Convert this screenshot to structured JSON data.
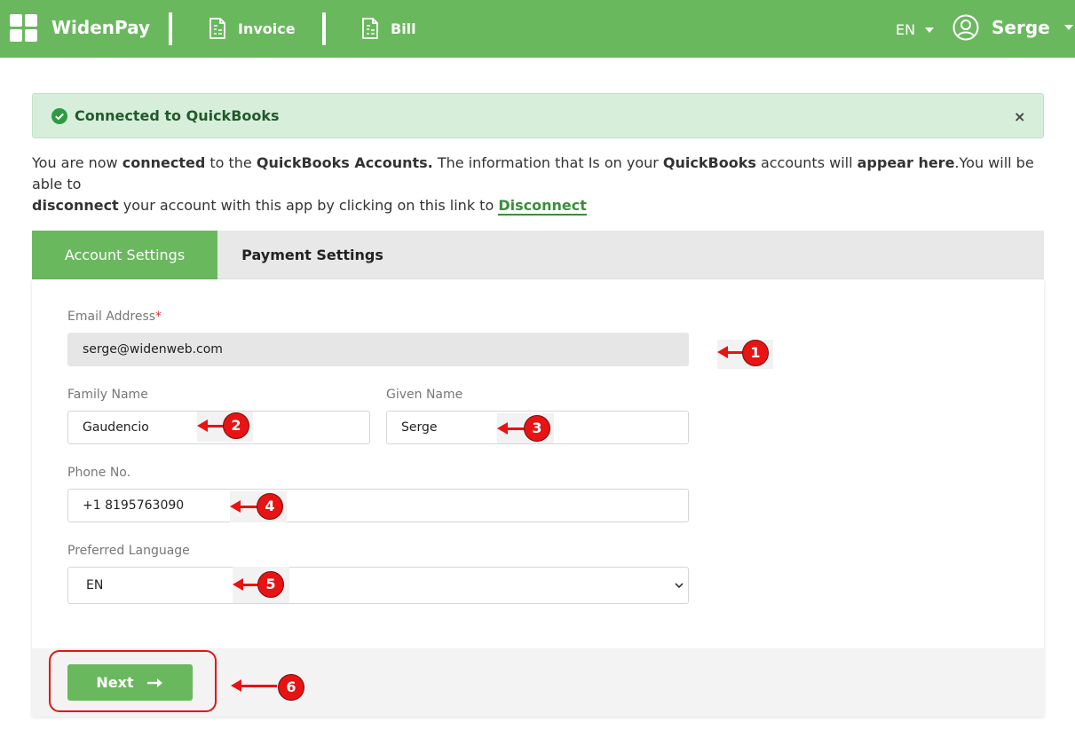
{
  "app": {
    "brand": "WidenPay",
    "nav": [
      {
        "label": "Invoice",
        "icon": "invoice-icon"
      },
      {
        "label": "Bill",
        "icon": "bill-icon"
      }
    ],
    "language": "EN",
    "user": "Serge",
    "brand_color": "#6ab85e"
  },
  "alert": {
    "text": "Connected to QuickBooks",
    "close": "×"
  },
  "info": {
    "p1": "You are now ",
    "b1": "connected",
    "p2": " to the ",
    "b2": "QuickBooks Accounts.",
    "p3": " The information that Is on your ",
    "b3": "QuickBooks",
    "p4": " accounts will ",
    "b4": "appear here",
    "p5": ".You will be able to ",
    "b5": "disconnect",
    "p6": " your account with this app by clicking on this link to ",
    "link": "Disconnect"
  },
  "tabs": {
    "account": "Account Settings",
    "payment": "Payment Settings"
  },
  "form": {
    "email_label": "Email Address",
    "email_required": "*",
    "email_value": "serge@widenweb.com",
    "family_label": "Family Name",
    "family_value": "Gaudencio",
    "given_label": "Given Name",
    "given_value": "Serge",
    "phone_label": "Phone No.",
    "phone_value": "+1 8195763090",
    "lang_label": "Preferred Language",
    "lang_value": "EN",
    "next_button": "Next"
  },
  "annotations": [
    "1",
    "2",
    "3",
    "4",
    "5",
    "6"
  ]
}
